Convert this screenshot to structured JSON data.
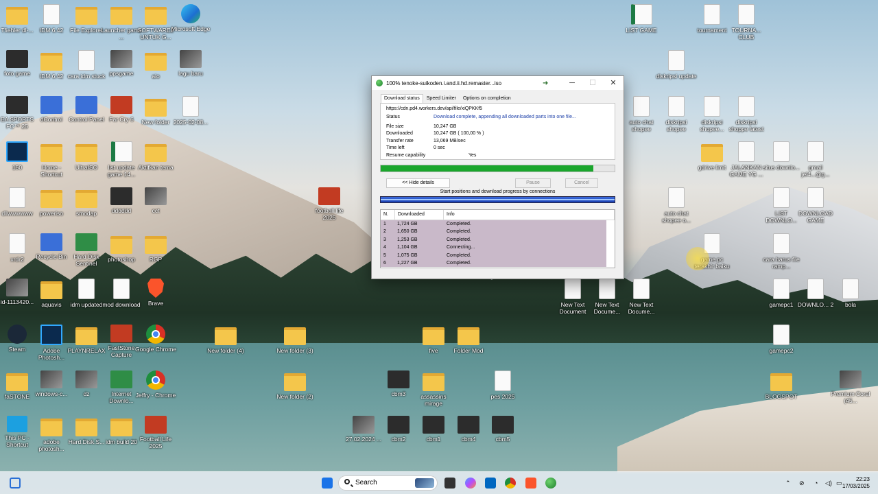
{
  "desktop": {
    "icons": [
      {
        "label": "Tfiehler dl-...",
        "type": "folder"
      },
      {
        "label": "IDM 6.42",
        "type": "doc"
      },
      {
        "label": "File Explorer",
        "type": "folder"
      },
      {
        "label": "Launcher game ...",
        "type": "folder"
      },
      {
        "label": "SOFTWARE2 UNTUK G...",
        "type": "folder"
      },
      {
        "label": "Microsoft Edge",
        "type": "edge"
      },
      {
        "label": "LIST GAME",
        "type": "xls"
      },
      {
        "label": "tournament",
        "type": "doc"
      },
      {
        "label": "TOURNA... CLUB",
        "type": "doc"
      },
      {
        "label": "foto game",
        "type": "dark"
      },
      {
        "label": "IDM 6.42",
        "type": "folder"
      },
      {
        "label": "cara idm stuck",
        "type": "doc"
      },
      {
        "label": "ppsgame",
        "type": "thumb"
      },
      {
        "label": "aio",
        "type": "folder"
      },
      {
        "label": "lagu baru",
        "type": "thumb"
      },
      {
        "label": "diskripsi update",
        "type": "doc"
      },
      {
        "label": "EA SPORTS FC™ 25",
        "type": "dark"
      },
      {
        "label": "dControl",
        "type": "app"
      },
      {
        "label": "Control Panel",
        "type": "app"
      },
      {
        "label": "Far Cry 6",
        "type": "red"
      },
      {
        "label": "New folder",
        "type": "folder"
      },
      {
        "label": "2025-02-08...",
        "type": "doc"
      },
      {
        "label": "auto chat shopee",
        "type": "doc"
      },
      {
        "label": "diskripsi shopee",
        "type": "doc"
      },
      {
        "label": "diskripsi shopee...",
        "type": "doc"
      },
      {
        "label": "diskripsi shoppe latest",
        "type": "doc"
      },
      {
        "label": "150",
        "type": "ps"
      },
      {
        "label": "Home - Shortcut",
        "type": "folder"
      },
      {
        "label": "UltraISO",
        "type": "folder"
      },
      {
        "label": "list update game 14...",
        "type": "xls"
      },
      {
        "label": "Aktifkan tema",
        "type": "folder"
      },
      {
        "label": "gdrive limit",
        "type": "folder"
      },
      {
        "label": "JALANKAN GAME YG ...",
        "type": "doc"
      },
      {
        "label": "situs downlo...",
        "type": "doc"
      },
      {
        "label": "gmail jel4...@g...",
        "type": "doc"
      },
      {
        "label": "dllwwwwww",
        "type": "doc"
      },
      {
        "label": "poweriso",
        "type": "folder"
      },
      {
        "label": "smodap",
        "type": "folder"
      },
      {
        "label": "dddddd",
        "type": "dark"
      },
      {
        "label": "cct",
        "type": "thumb"
      },
      {
        "label": "football life 2025",
        "type": "red"
      },
      {
        "label": "auto chat shopee o...",
        "type": "doc"
      },
      {
        "label": "LIST DOWNLO...",
        "type": "doc"
      },
      {
        "label": "DOWNLOAD GAME",
        "type": "doc"
      },
      {
        "label": "xrdr2",
        "type": "doc"
      },
      {
        "label": "Recycle Bin",
        "type": "app"
      },
      {
        "label": "Hard Disk Sentinel",
        "type": "green"
      },
      {
        "label": "photoshop",
        "type": "folder"
      },
      {
        "label": "RGP",
        "type": "folder"
      },
      {
        "label": "game pc terakhir baiku",
        "type": "doc"
      },
      {
        "label": "cara harus file ramp...",
        "type": "doc"
      },
      {
        "label": "id-1113420...",
        "type": "thumb"
      },
      {
        "label": "aquavis",
        "type": "folder"
      },
      {
        "label": "idm updated",
        "type": "doc"
      },
      {
        "label": "mod download",
        "type": "doc"
      },
      {
        "label": "Brave",
        "type": "brave"
      },
      {
        "label": "New Text Document",
        "type": "doc"
      },
      {
        "label": "New Text Docume...",
        "type": "doc"
      },
      {
        "label": "New Text Docume...",
        "type": "doc"
      },
      {
        "label": "gamepc1",
        "type": "doc"
      },
      {
        "label": "DOWNLO... 2",
        "type": "doc"
      },
      {
        "label": "bola",
        "type": "doc"
      },
      {
        "label": "Steam",
        "type": "steam"
      },
      {
        "label": "Adobe Photosh...",
        "type": "ps"
      },
      {
        "label": "PLAYNRELAX",
        "type": "folder"
      },
      {
        "label": "FastStone Capture",
        "type": "red"
      },
      {
        "label": "Google Chrome",
        "type": "chrome"
      },
      {
        "label": "New folder (4)",
        "type": "folder"
      },
      {
        "label": "New folder (3)",
        "type": "folder"
      },
      {
        "label": "five",
        "type": "folder"
      },
      {
        "label": "Folder Mod",
        "type": "folder"
      },
      {
        "label": "gamepc2",
        "type": "doc"
      },
      {
        "label": "faSTONE",
        "type": "folder"
      },
      {
        "label": "windows-c...",
        "type": "thumb"
      },
      {
        "label": "dz",
        "type": "thumb"
      },
      {
        "label": "Internet Downlo...",
        "type": "green"
      },
      {
        "label": "Jeffry - Chrome",
        "type": "chrome"
      },
      {
        "label": "New folder (2)",
        "type": "folder"
      },
      {
        "label": "cbm3",
        "type": "dark"
      },
      {
        "label": "assassins mirage",
        "type": "folder"
      },
      {
        "label": "pes 2025",
        "type": "doc"
      },
      {
        "label": "BLOGSPOT",
        "type": "folder"
      },
      {
        "label": "Premium Coral (45...",
        "type": "thumb"
      },
      {
        "label": "This PC - Shortcut",
        "type": "screen"
      },
      {
        "label": "adobe photosh...",
        "type": "folder"
      },
      {
        "label": "Hard.Disk.S...",
        "type": "folder"
      },
      {
        "label": "idm build 20",
        "type": "folder"
      },
      {
        "label": "Football Life 2025",
        "type": "red"
      },
      {
        "label": "27.02.2024 ...",
        "type": "thumb"
      },
      {
        "label": "cbm2",
        "type": "dark"
      },
      {
        "label": "cbm1",
        "type": "dark"
      },
      {
        "label": "cbm4",
        "type": "dark"
      },
      {
        "label": "cbm5",
        "type": "dark"
      }
    ]
  },
  "idm": {
    "title": "100% tenoke-suikoden.i.and.ii.hd.remaster...iso",
    "minimize": "─",
    "maximize": "☐",
    "close": "✕",
    "tabs": [
      "Download status",
      "Speed Limiter",
      "Options on completion"
    ],
    "url": "https://cdn.pd4.workers.dev/api/file/xiQPKKf5",
    "status_label": "Status",
    "status_value": "Download complete, appending all downloaded parts into one file...",
    "file_size_label": "File size",
    "file_size": "10,247  GB",
    "downloaded_label": "Downloaded",
    "downloaded": "10,247  GB  ( 100,00 % )",
    "transfer_rate_label": "Transfer rate",
    "transfer_rate": "13,069  MB/sec",
    "time_left_label": "Time left",
    "time_left": "0 sec",
    "resume_label": "Resume capability",
    "resume": "Yes",
    "progress_fraction": 0.91,
    "hide_details": "<< Hide details",
    "pause": "Pause",
    "cancel": "Cancel",
    "connections_caption": "Start positions and download progress by connections",
    "table_headers": [
      "N.",
      "Downloaded",
      "Info"
    ],
    "connections": [
      {
        "n": "1",
        "downloaded": "1,724  GB",
        "info": "Completed."
      },
      {
        "n": "2",
        "downloaded": "1,650  GB",
        "info": "Completed."
      },
      {
        "n": "3",
        "downloaded": "1,253  GB",
        "info": "Completed."
      },
      {
        "n": "4",
        "downloaded": "1,104  GB",
        "info": "Connecting..."
      },
      {
        "n": "5",
        "downloaded": "1,075  GB",
        "info": "Completed."
      },
      {
        "n": "6",
        "downloaded": "1,227  GB",
        "info": "Completed."
      }
    ]
  },
  "taskbar": {
    "search_placeholder": "Search",
    "time": "22:23",
    "date": "17/03/2025"
  }
}
